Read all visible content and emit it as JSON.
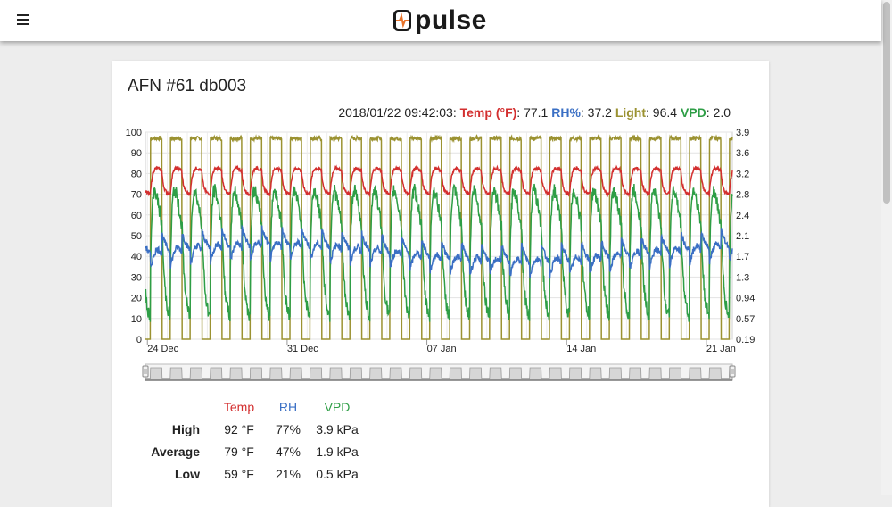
{
  "app": {
    "logo_text": "pulse",
    "menu_icon": "menu-icon",
    "logo_icon": "pulse-logo-icon",
    "accent": "#e8732a"
  },
  "card": {
    "title": "AFN #61 db003"
  },
  "readout": {
    "timestamp": "2018/01/22 09:42:03:",
    "temp_label": "Temp (°F)",
    "temp_value": ": 77.1",
    "rh_label": "RH%",
    "rh_value": ": 37.2",
    "light_label": "Light",
    "light_value": ": 96.4",
    "vpd_label": "VPD",
    "vpd_value": ": 2.0"
  },
  "chart_data": {
    "type": "line",
    "x": {
      "tick_labels": [
        "24 Dec",
        "31 Dec",
        "07 Jan",
        "14 Jan",
        "21 Jan"
      ],
      "start": "2017-12-24",
      "end": "2018-01-22"
    },
    "y_left": {
      "ticks": [
        "0",
        "10",
        "20",
        "30",
        "40",
        "50",
        "60",
        "70",
        "80",
        "90",
        "100"
      ],
      "range": [
        0,
        100
      ]
    },
    "y_right": {
      "ticks": [
        "0.19",
        "0.57",
        "0.94",
        "1.3",
        "1.7",
        "2.1",
        "2.4",
        "2.8",
        "3.2",
        "3.6",
        "3.9"
      ],
      "range": [
        0.19,
        3.9
      ]
    },
    "grid": true,
    "legend": "none",
    "series": [
      {
        "name": "Temp (°F)",
        "color": "#d32f2f",
        "axis": "left",
        "pattern": "daily",
        "day_min": 70,
        "day_max": 86
      },
      {
        "name": "RH%",
        "color": "#3a6fc4",
        "axis": "left",
        "pattern": "daily",
        "day_min": 34,
        "day_max": 52
      },
      {
        "name": "Light",
        "color": "#9b9231",
        "axis": "left",
        "pattern": "on-off",
        "on_value": 97,
        "off_value": 0
      },
      {
        "name": "VPD",
        "color": "#2e9e46",
        "axis": "right",
        "pattern": "daily",
        "day_min": 0.5,
        "day_max": 3.9
      }
    ]
  },
  "stats": {
    "headers": {
      "temp": "Temp",
      "rh": "RH",
      "vpd": "VPD"
    },
    "rows": [
      {
        "label": "High",
        "temp": "92 °F",
        "rh": "77%",
        "vpd": "3.9 kPa"
      },
      {
        "label": "Average",
        "temp": "79 °F",
        "rh": "47%",
        "vpd": "1.9 kPa"
      },
      {
        "label": "Low",
        "temp": "59 °F",
        "rh": "21%",
        "vpd": "0.5 kPa"
      }
    ]
  }
}
